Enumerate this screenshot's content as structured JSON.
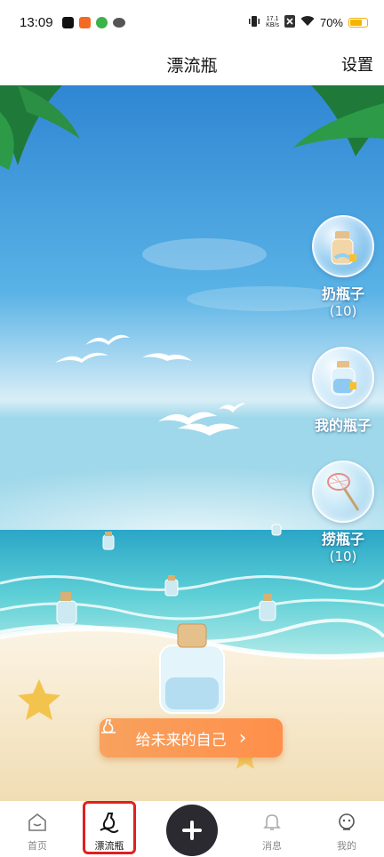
{
  "status": {
    "time": "13:09",
    "net_speed_value": "17.1",
    "net_speed_unit": "KB/s",
    "battery": "70%",
    "battery_level": 0.7
  },
  "header": {
    "title": "漂流瓶",
    "settings_label": "设置"
  },
  "actions": {
    "throw": {
      "label": "扔瓶子",
      "count": "(10)"
    },
    "mine": {
      "label": "我的瓶子"
    },
    "fish": {
      "label": "捞瓶子",
      "count": "(10)"
    }
  },
  "future_button": {
    "label": "给未来的自己",
    "arrow": "›"
  },
  "nav": {
    "home": "首页",
    "bottle": "漂流瓶",
    "messages": "消息",
    "me": "我的"
  },
  "colors": {
    "sky_top": "#3a8ed6",
    "sea": "#36b8c8",
    "sand": "#f6ead0",
    "accent_orange": "#ff8f4a",
    "highlight_red": "#e02020"
  }
}
